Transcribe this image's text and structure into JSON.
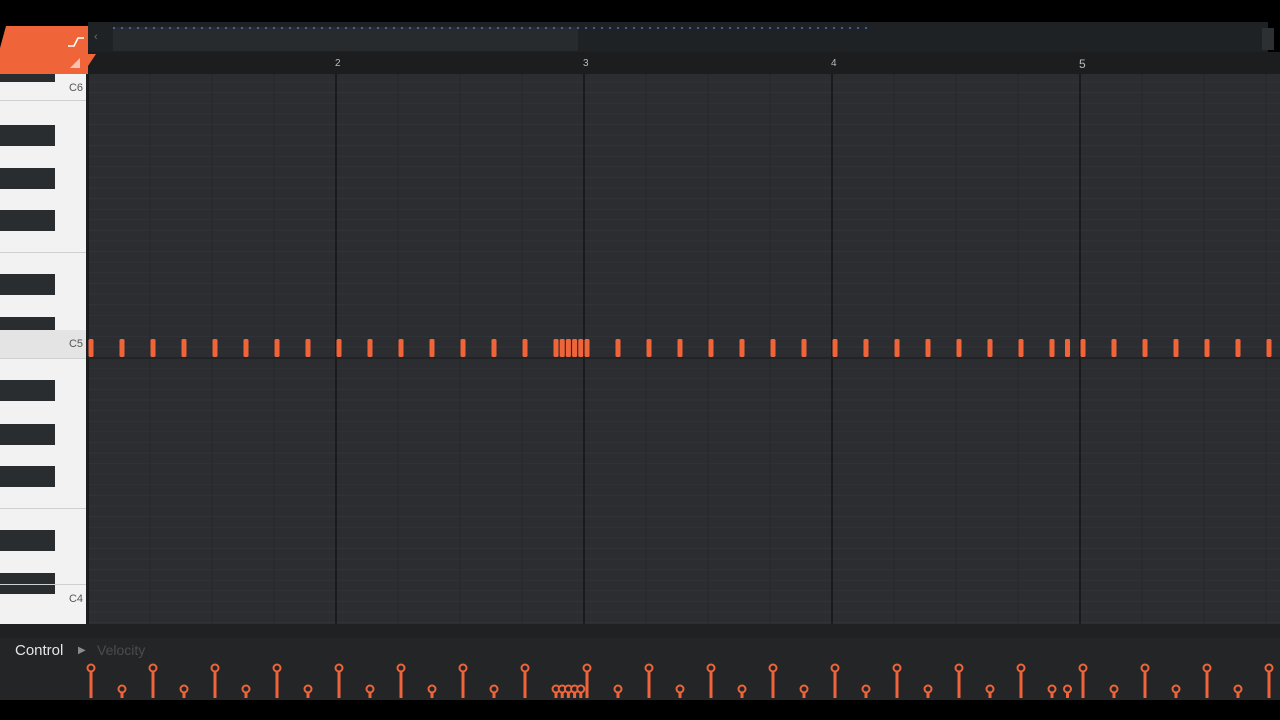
{
  "colors": {
    "accent": "#f0643a",
    "grid_bg": "#2b2d30",
    "piano_white": "#f2f2f2",
    "piano_black": "#2a2d30"
  },
  "ruler": {
    "bars": [
      "2",
      "3",
      "4",
      "5"
    ]
  },
  "piano": {
    "labels": [
      "C6",
      "C5",
      "C4"
    ]
  },
  "control": {
    "label": "Control",
    "parameter": "Velocity"
  },
  "notes": {
    "pitch": "C5",
    "times": [
      0,
      0.125,
      0.25,
      0.375,
      0.5,
      0.625,
      0.75,
      0.875,
      1.0,
      1.125,
      1.25,
      1.375,
      1.5,
      1.625,
      1.75,
      1.875,
      1.9,
      1.925,
      1.95,
      1.975,
      2.0,
      2.125,
      2.25,
      2.375,
      2.5,
      2.625,
      2.75,
      2.875,
      3.0,
      3.125,
      3.25,
      3.375,
      3.5,
      3.625,
      3.75,
      3.875,
      3.9375,
      4.0,
      4.125,
      4.25,
      4.375,
      4.5,
      4.625,
      4.75
    ],
    "velocities": [
      1,
      0.3,
      1,
      0.3,
      1,
      0.3,
      1,
      0.3,
      1,
      0.3,
      1,
      0.3,
      1,
      0.3,
      1,
      0.3,
      0.3,
      0.3,
      0.3,
      0.3,
      1,
      0.3,
      1,
      0.3,
      1,
      0.3,
      1,
      0.3,
      1,
      0.3,
      1,
      0.3,
      1,
      0.3,
      1,
      0.3,
      0.3,
      1,
      0.3,
      1,
      0.3,
      1,
      0.3,
      1
    ]
  }
}
